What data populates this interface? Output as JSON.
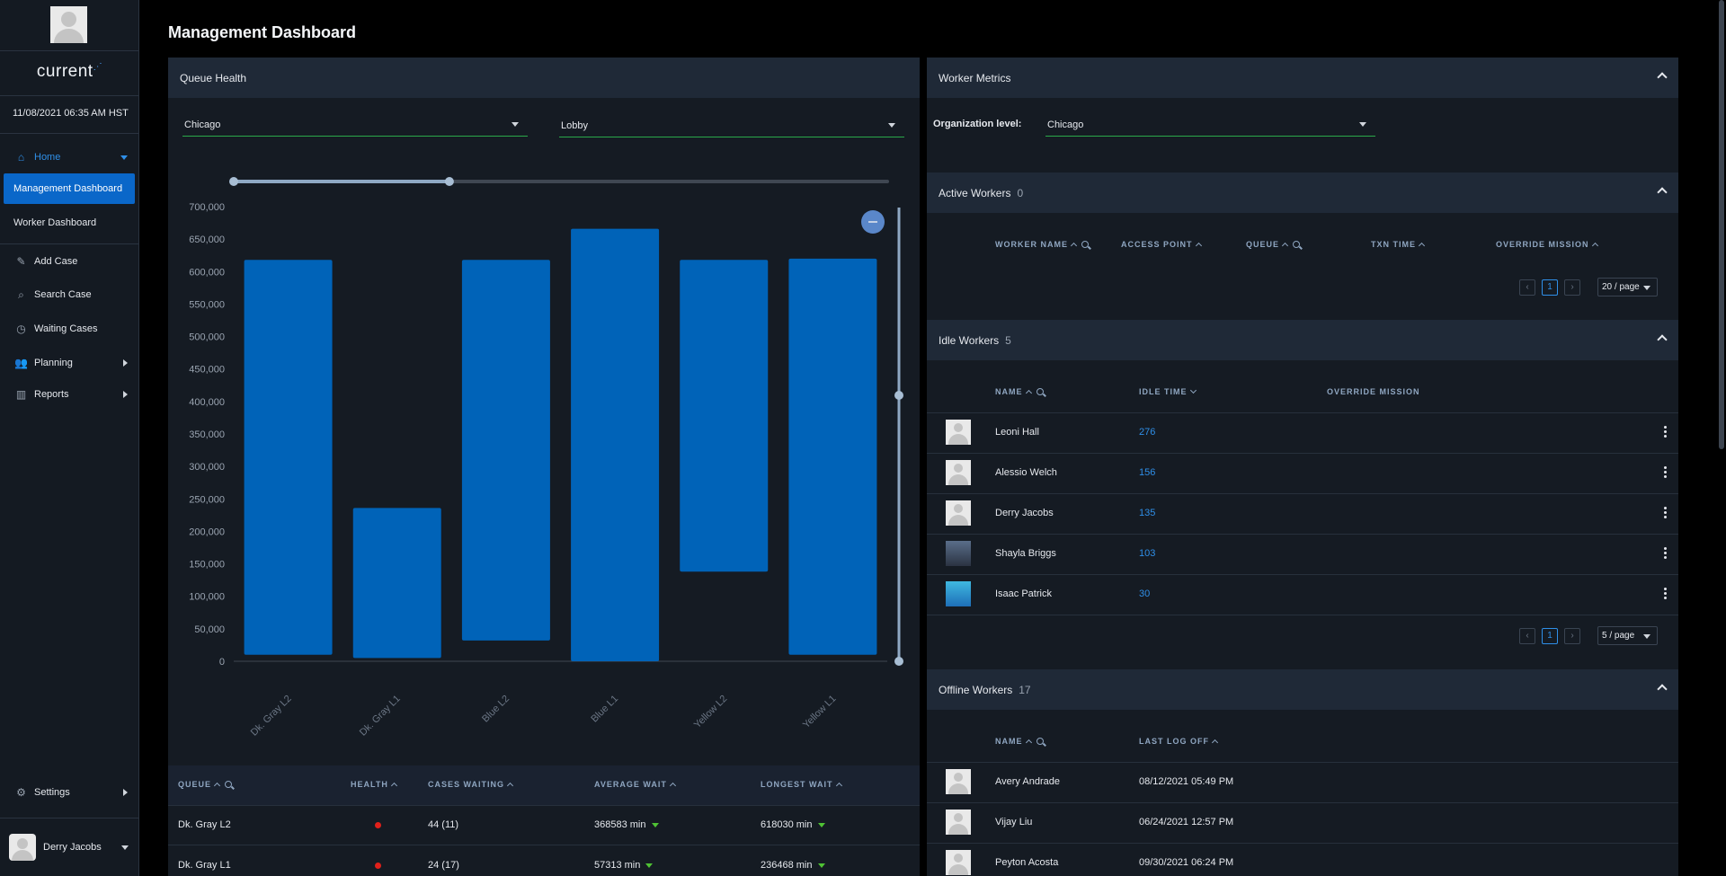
{
  "app": {
    "logo_text": "current",
    "datetime": "11/08/2021 06:35 AM HST"
  },
  "sidebar": {
    "items": [
      {
        "label": "Home",
        "icon": "home-icon"
      },
      {
        "label": "Management Dashboard"
      },
      {
        "label": "Worker Dashboard"
      },
      {
        "label": "Add Case",
        "icon": "pencil-icon"
      },
      {
        "label": "Search Case",
        "icon": "search-icon"
      },
      {
        "label": "Waiting Cases",
        "icon": "clock-icon"
      },
      {
        "label": "Planning",
        "icon": "people-icon"
      },
      {
        "label": "Reports",
        "icon": "report-icon"
      }
    ],
    "settings_label": "Settings",
    "user_name": "Derry Jacobs"
  },
  "page": {
    "title": "Management Dashboard"
  },
  "queue_health": {
    "title": "Queue Health",
    "location_select": "Chicago",
    "area_select": "Lobby",
    "slider": {
      "start": 0,
      "end": 0.33
    },
    "table": {
      "headers": [
        "QUEUE",
        "HEALTH",
        "CASES WAITING",
        "AVERAGE WAIT",
        "LONGEST WAIT"
      ],
      "rows": [
        {
          "queue": "Dk. Gray L2",
          "health": "red",
          "cases": "44 (11)",
          "avg": "368583 min",
          "longest": "618030 min"
        },
        {
          "queue": "Dk. Gray L1",
          "health": "red",
          "cases": "24 (17)",
          "avg": "57313 min",
          "longest": "236468 min"
        }
      ]
    }
  },
  "chart_data": {
    "type": "bar",
    "categories": [
      "Dk. Gray L2",
      "Dk. Gray L1",
      "Blue L2",
      "Blue L1",
      "Yellow L2",
      "Yellow L1"
    ],
    "ranges": [
      [
        10000,
        618000
      ],
      [
        5000,
        236000
      ],
      [
        32000,
        618000
      ],
      [
        0,
        666000
      ],
      [
        138000,
        618000
      ],
      [
        10000,
        620000
      ]
    ],
    "yticks": [
      "700,000",
      "650,000",
      "600,000",
      "550,000",
      "500,000",
      "450,000",
      "400,000",
      "350,000",
      "300,000",
      "250,000",
      "200,000",
      "150,000",
      "100,000",
      "50,000",
      "0"
    ],
    "ylim": [
      0,
      700000
    ],
    "bar_color": "#0063b8",
    "title": "",
    "xlabel": "",
    "ylabel": ""
  },
  "worker_metrics": {
    "title": "Worker Metrics",
    "org_label": "Organization level:",
    "org_select": "Chicago",
    "active": {
      "title": "Active Workers",
      "count": "0",
      "headers": [
        "WORKER NAME",
        "ACCESS POINT",
        "QUEUE",
        "TXN TIME",
        "OVERRIDE MISSION"
      ],
      "page": "1",
      "page_size": "20 / page"
    },
    "idle": {
      "title": "Idle Workers",
      "count": "5",
      "headers": [
        "NAME",
        "IDLE TIME",
        "OVERRIDE MISSION"
      ],
      "rows": [
        {
          "name": "Leoni Hall",
          "time": "276"
        },
        {
          "name": "Alessio Welch",
          "time": "156"
        },
        {
          "name": "Derry Jacobs",
          "time": "135"
        },
        {
          "name": "Shayla Briggs",
          "time": "103"
        },
        {
          "name": "Isaac Patrick",
          "time": "30"
        }
      ],
      "page": "1",
      "page_size": "5 / page"
    },
    "offline": {
      "title": "Offline Workers",
      "count": "17",
      "headers": [
        "NAME",
        "LAST LOG OFF"
      ],
      "rows": [
        {
          "name": "Avery Andrade",
          "time": "08/12/2021 05:49 PM"
        },
        {
          "name": "Vijay Liu",
          "time": "06/24/2021 12:57 PM"
        },
        {
          "name": "Peyton Acosta",
          "time": "09/30/2021 06:24 PM"
        }
      ]
    }
  },
  "colors": {
    "accent": "#2f8fe8",
    "active_nav": "#0a67c9",
    "health_red": "#e0201a",
    "trend_green": "#4fc234"
  }
}
